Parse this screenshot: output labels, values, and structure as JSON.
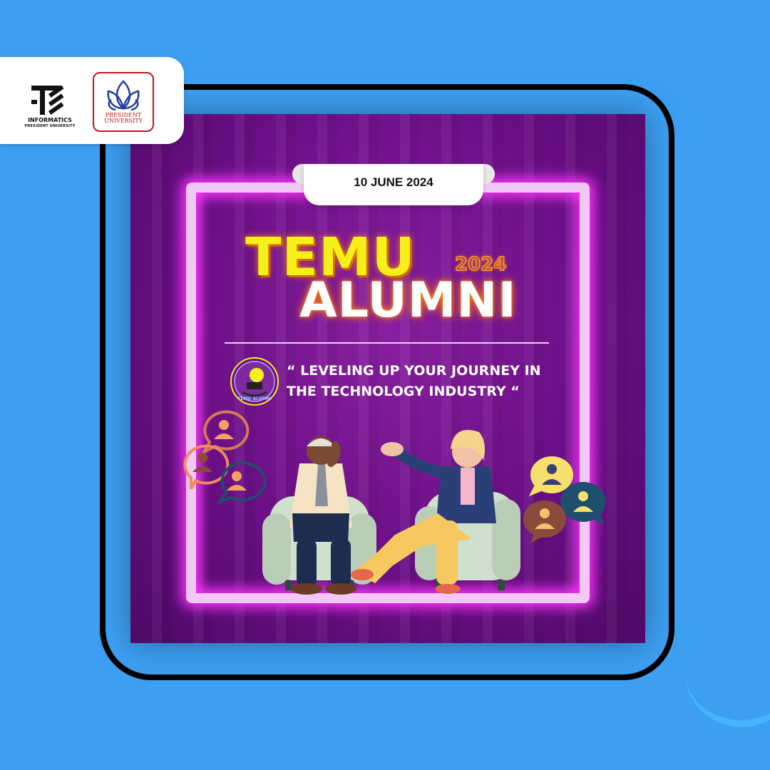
{
  "logos": {
    "informatics_line1": "INFORMATICS",
    "informatics_line2": "PRESIDENT UNIVERSITY",
    "president_line1": "PRESIDENT",
    "president_line2": "UNIVERSITY"
  },
  "event": {
    "date": "10 JUNE 2024",
    "title_line1": "TEMU",
    "title_line2": "ALUMNI",
    "year": "2024",
    "badge_text": "TEMU ALUMNI",
    "tagline_line1": "“ LEVELING UP YOUR JOURNEY IN",
    "tagline_line2": "THE TECHNOLOGY INDUSTRY “"
  },
  "colors": {
    "background": "#3d9ff2",
    "card_purple": "#6a0f85",
    "neon_pink": "#ff35ff",
    "title_yellow": "#f5ef1a",
    "year_orange": "#f58b1f"
  }
}
